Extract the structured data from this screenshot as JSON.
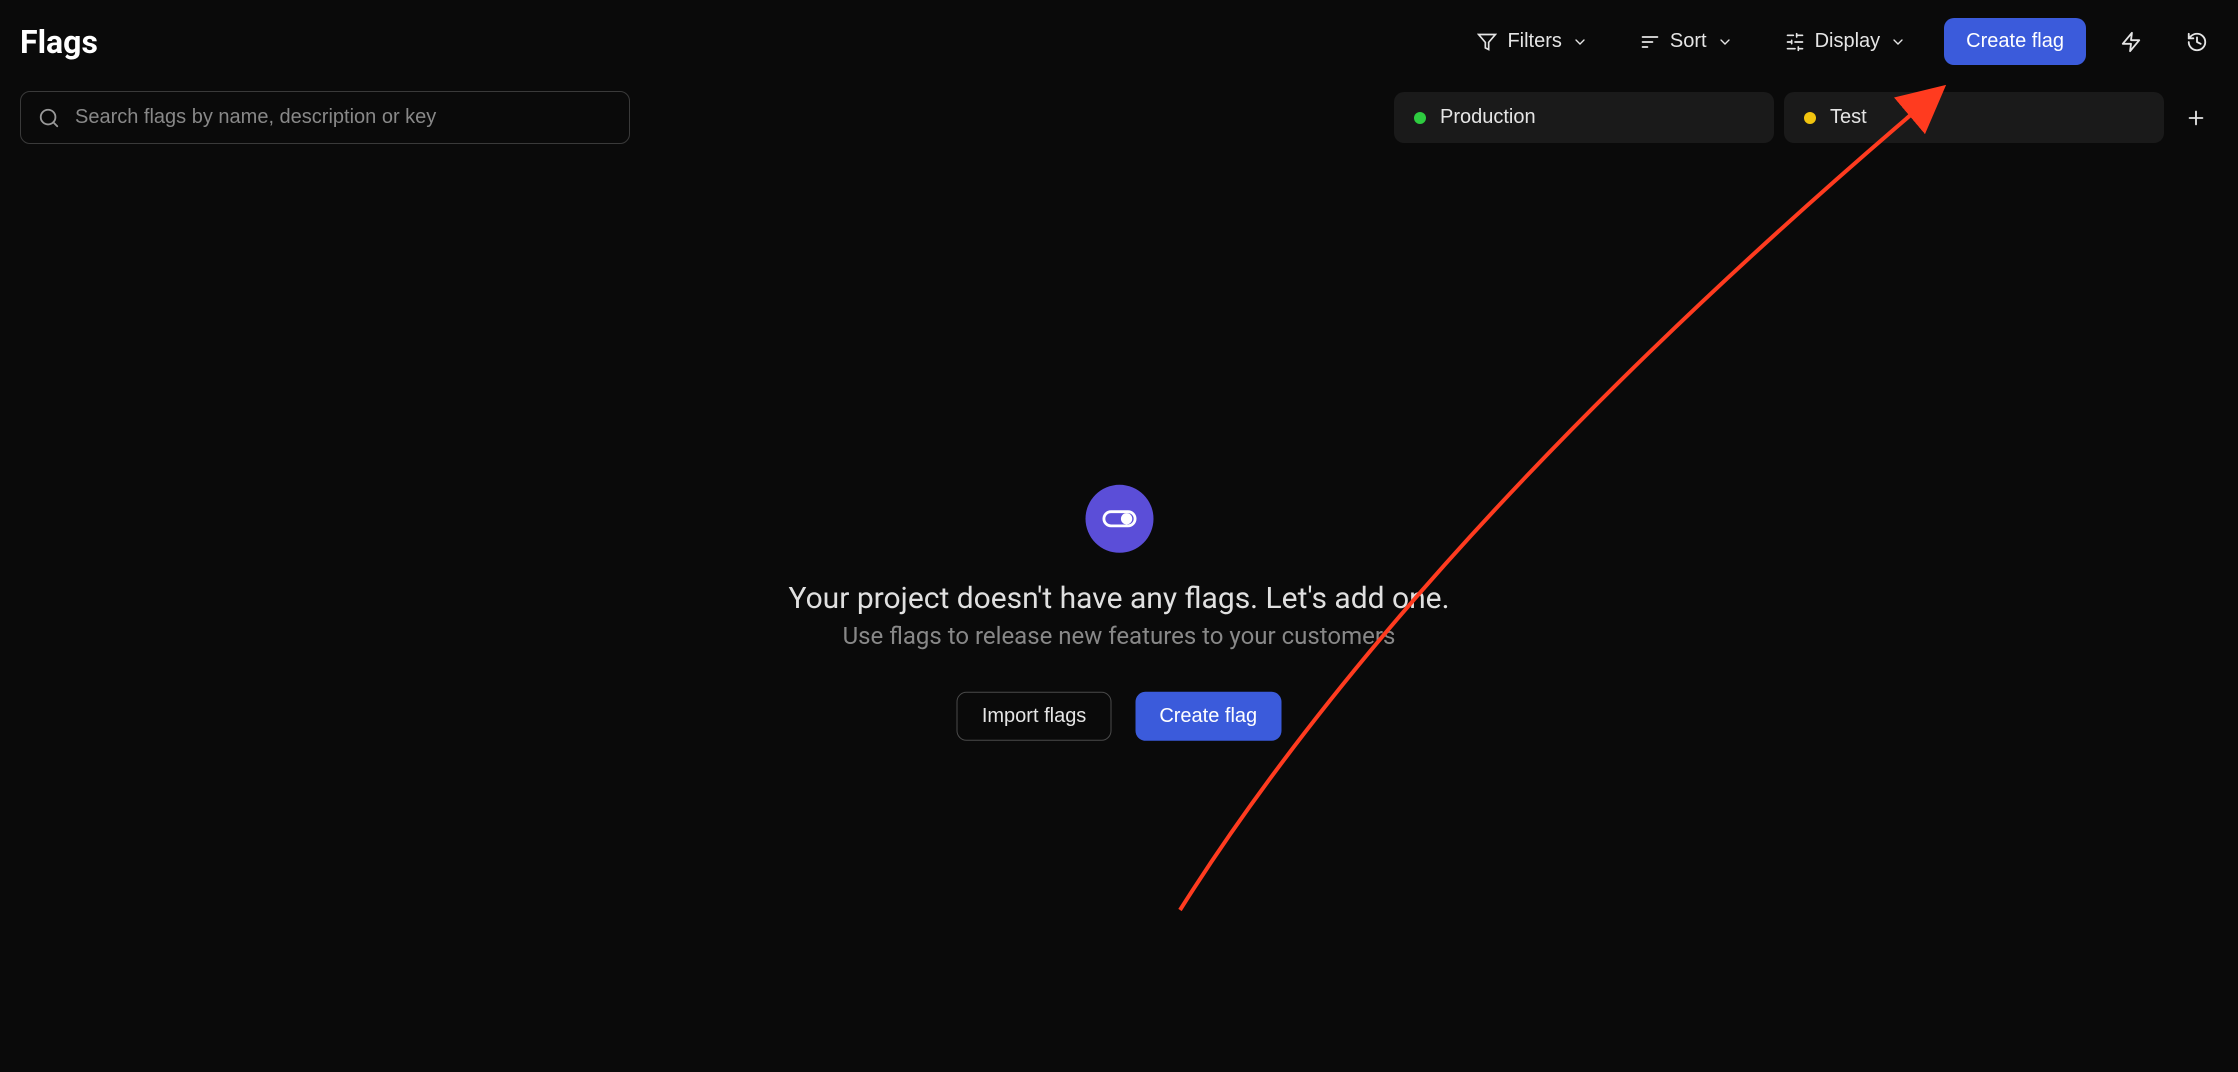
{
  "header": {
    "title": "Flags",
    "filters_label": "Filters",
    "sort_label": "Sort",
    "display_label": "Display",
    "create_flag_label": "Create flag"
  },
  "search": {
    "placeholder": "Search flags by name, description or key",
    "value": ""
  },
  "environments": [
    {
      "name": "Production",
      "color": "green"
    },
    {
      "name": "Test",
      "color": "yellow"
    }
  ],
  "empty_state": {
    "title": "Your project doesn't have any flags. Let's add one.",
    "subtitle": "Use flags to release new features to your customers",
    "import_label": "Import flags",
    "create_label": "Create flag"
  }
}
